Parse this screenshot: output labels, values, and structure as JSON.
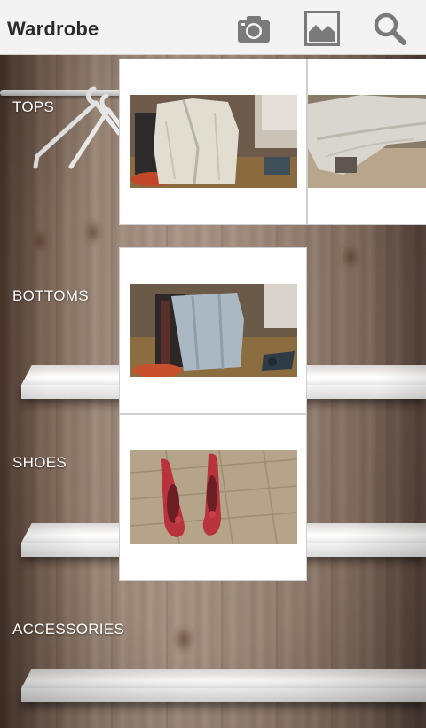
{
  "action_bar": {
    "title": "Wardrobe",
    "actions": [
      {
        "icon": "camera-icon"
      },
      {
        "icon": "gallery-icon"
      },
      {
        "icon": "search-icon"
      }
    ]
  },
  "categories": [
    {
      "label": "TOPS"
    },
    {
      "label": "BOTTOMS"
    },
    {
      "label": "SHOES"
    },
    {
      "label": "ACCESSORIES"
    }
  ],
  "items": [
    {
      "category": "TOPS",
      "photo": "striped-shirt-on-chair"
    },
    {
      "category": "TOPS",
      "photo": "striped-shirt-on-bed"
    },
    {
      "category": "BOTTOMS",
      "photo": "jeans-on-chair"
    },
    {
      "category": "SHOES",
      "photo": "red-heels-on-parquet"
    }
  ],
  "colors": {
    "action_bar_bg": "#f3f3f3",
    "title_text": "#2b2b2b",
    "icon_gray": "#7a7a7a",
    "label_text": "#ffffff",
    "card_bg": "#ffffff"
  }
}
